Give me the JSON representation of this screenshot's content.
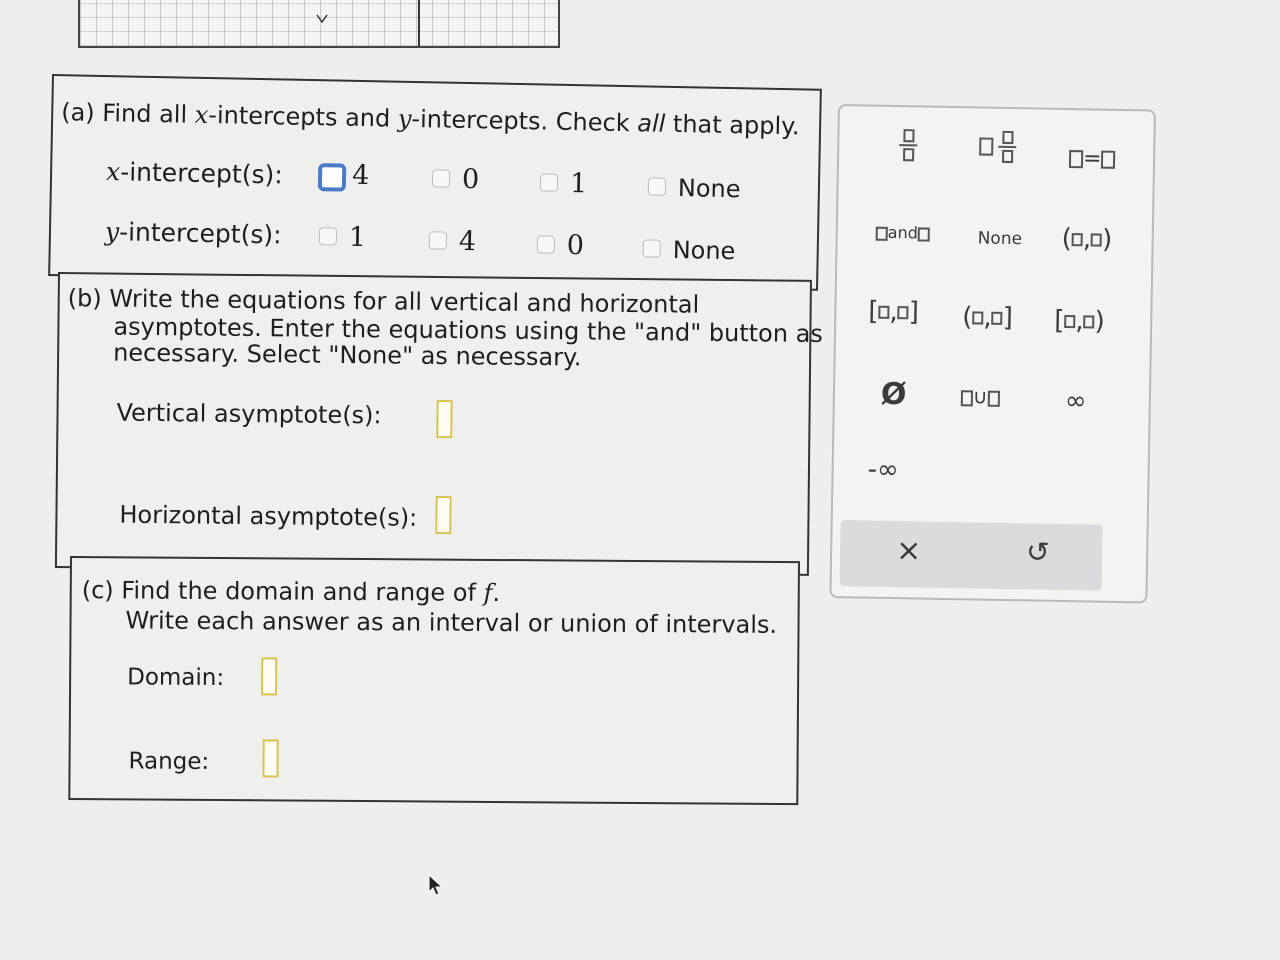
{
  "part_a": {
    "prompt_pre": "(a) Find all ",
    "prompt_x": "x",
    "prompt_mid": "-intercepts and ",
    "prompt_y": "y",
    "prompt_post": "-intercepts. Check ",
    "prompt_all": "all",
    "prompt_end": " that apply.",
    "x_label_var": "x",
    "x_label_rest": "-intercept(s):",
    "y_label_var": "y",
    "y_label_rest": "-intercept(s):",
    "x_options": [
      "4",
      "0",
      "1",
      "None"
    ],
    "y_options": [
      "1",
      "4",
      "0",
      "None"
    ]
  },
  "part_b": {
    "line1": "(b) Write the equations for all vertical and horizontal",
    "line2": "asymptotes. Enter the equations using the \"and\" button as",
    "line3": "necessary. Select \"None\" as necessary.",
    "vertical_label": "Vertical asymptote(s):",
    "horizontal_label": "Horizontal asymptote(s):"
  },
  "part_c": {
    "line1_pre": "(c) Find the domain and range of ",
    "line1_var": "f",
    "line1_post": ".",
    "line2": "Write each answer as an interval or union of intervals.",
    "domain_label": "Domain:",
    "range_label": "Range:"
  },
  "palette": {
    "and_label": "and",
    "none_label": "None",
    "equals": "=",
    "comma": ",",
    "empty_set": "Ø",
    "union": "∪",
    "infinity": "∞",
    "neg_infinity": "-∞",
    "clear": "×",
    "undo": "↺"
  },
  "colors": {
    "checked_border": "#4a7bc8",
    "answer_box_border": "#d9c355"
  }
}
